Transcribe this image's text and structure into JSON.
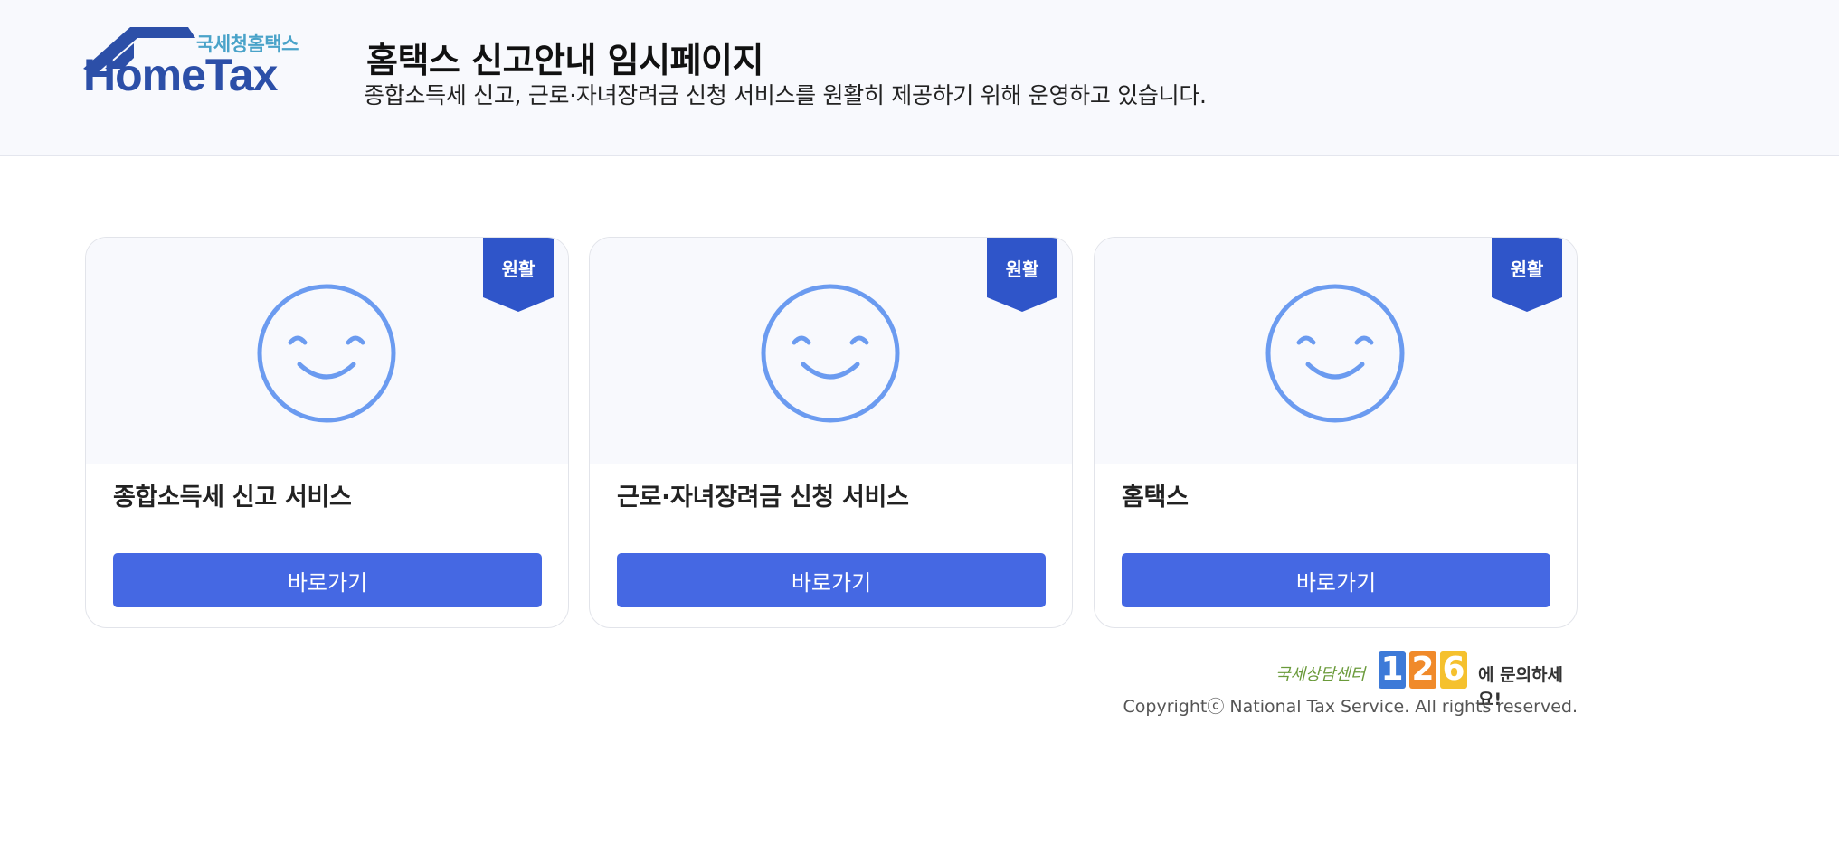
{
  "header": {
    "logo_ko": "국세청홈택스",
    "logo_en": "HomeTax",
    "title": "홈택스 신고안내 임시페이지",
    "subtitle": "종합소득세 신고, 근로·자녀장려금 신청 서비스를 원활히 제공하기 위해 운영하고 있습니다."
  },
  "cards": [
    {
      "badge": "원활",
      "title": "종합소득세 신고 서비스",
      "button": "바로가기"
    },
    {
      "badge": "원활",
      "title": "근로·자녀장려금 신청 서비스",
      "button": "바로가기"
    },
    {
      "badge": "원활",
      "title": "홈택스",
      "button": "바로가기"
    }
  ],
  "footer": {
    "contact_prefix": "국세상담센터",
    "contact_digits": [
      "1",
      "2",
      "6"
    ],
    "contact_suffix": "에 문의하세요!",
    "copyright": "Copyrightⓒ National Tax Service. All rights reserved."
  },
  "colors": {
    "accent": "#4568e3",
    "badge": "#2f55c9",
    "smiley": "#6b9bf0",
    "logo_blue": "#2c4fa8",
    "logo_teal": "#4aa3c9"
  },
  "icons": {
    "logo": "house-roof-icon",
    "card_media": "smiley-face-icon",
    "badge": "ribbon-badge-icon"
  }
}
